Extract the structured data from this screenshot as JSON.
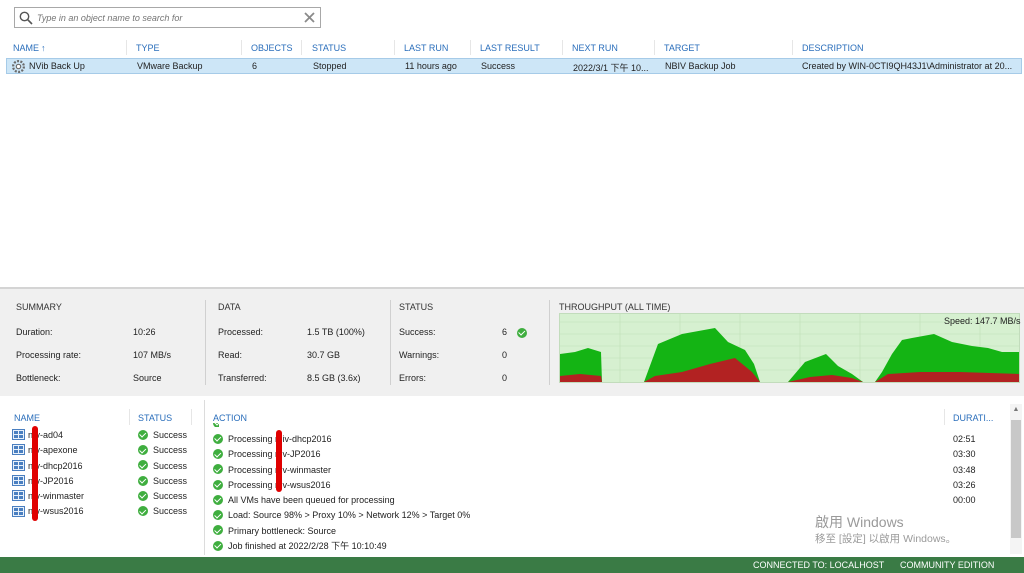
{
  "search": {
    "placeholder": "Type in an object name to search for"
  },
  "jobs": {
    "columns": [
      "NAME",
      "TYPE",
      "OBJECTS",
      "STATUS",
      "LAST RUN",
      "LAST RESULT",
      "NEXT RUN",
      "TARGET",
      "DESCRIPTION"
    ],
    "rows": [
      {
        "name": "NVib Back Up",
        "type": "VMware Backup",
        "objects": "6",
        "status": "Stopped",
        "last_run": "11 hours ago",
        "last_result": "Success",
        "next_run": "2022/3/1 下午 10...",
        "target": "NBIV Backup Job",
        "description": "Created by WIN-0CTI9QH43J1\\Administrator at 20..."
      }
    ]
  },
  "summary": {
    "title": "SUMMARY",
    "duration_label": "Duration:",
    "duration": "10:26",
    "rate_label": "Processing rate:",
    "rate": "107 MB/s",
    "bottleneck_label": "Bottleneck:",
    "bottleneck": "Source"
  },
  "data": {
    "title": "DATA",
    "processed_label": "Processed:",
    "processed": "1.5 TB (100%)",
    "read_label": "Read:",
    "read": "30.7 GB",
    "transferred_label": "Transferred:",
    "transferred": "8.5 GB (3.6x)"
  },
  "status": {
    "title": "STATUS",
    "success_label": "Success:",
    "success": "6",
    "warnings_label": "Warnings:",
    "warnings": "0",
    "errors_label": "Errors:",
    "errors": "0"
  },
  "throughput": {
    "title": "THROUGHPUT (ALL TIME)",
    "speed": "Speed: 147.7 MB/s",
    "colors": {
      "bg": "#d6f0d0",
      "read": "#14b414",
      "transferred": "#b22222"
    }
  },
  "vms": {
    "name_header": "NAME",
    "status_header": "STATUS",
    "items": [
      {
        "name": "n  v-ad04",
        "status": "Success"
      },
      {
        "name": "n  v-apexone",
        "status": "Success"
      },
      {
        "name": "n  v-dhcp2016",
        "status": "Success"
      },
      {
        "name": "n  v-JP2016",
        "status": "Success"
      },
      {
        "name": "n  v-winmaster",
        "status": "Success"
      },
      {
        "name": "n  v-wsus2016",
        "status": "Success"
      }
    ]
  },
  "actions": {
    "action_header": "ACTION",
    "duration_header": "DURATI...",
    "items": [
      {
        "text": "Processing n  iv-dhcp2016",
        "duration": "02:51"
      },
      {
        "text": "Processing n  v-JP2016",
        "duration": "03:30"
      },
      {
        "text": "Processing n  v-winmaster",
        "duration": "03:48"
      },
      {
        "text": "Processing n  v-wsus2016",
        "duration": "03:26"
      },
      {
        "text": "All VMs have been queued for processing",
        "duration": "00:00"
      },
      {
        "text": "Load: Source 98% > Proxy 10% > Network 12% > Target 0%",
        "duration": ""
      },
      {
        "text": "Primary bottleneck: Source",
        "duration": ""
      },
      {
        "text": "Job finished at 2022/2/28 下午 10:10:49",
        "duration": ""
      }
    ]
  },
  "watermark": {
    "line1": "啟用 Windows",
    "line2": "移至 [設定] 以啟用 Windows。"
  },
  "statusbar": {
    "connected": "CONNECTED TO: LOCALHOST",
    "edition": "COMMUNITY EDITION"
  }
}
